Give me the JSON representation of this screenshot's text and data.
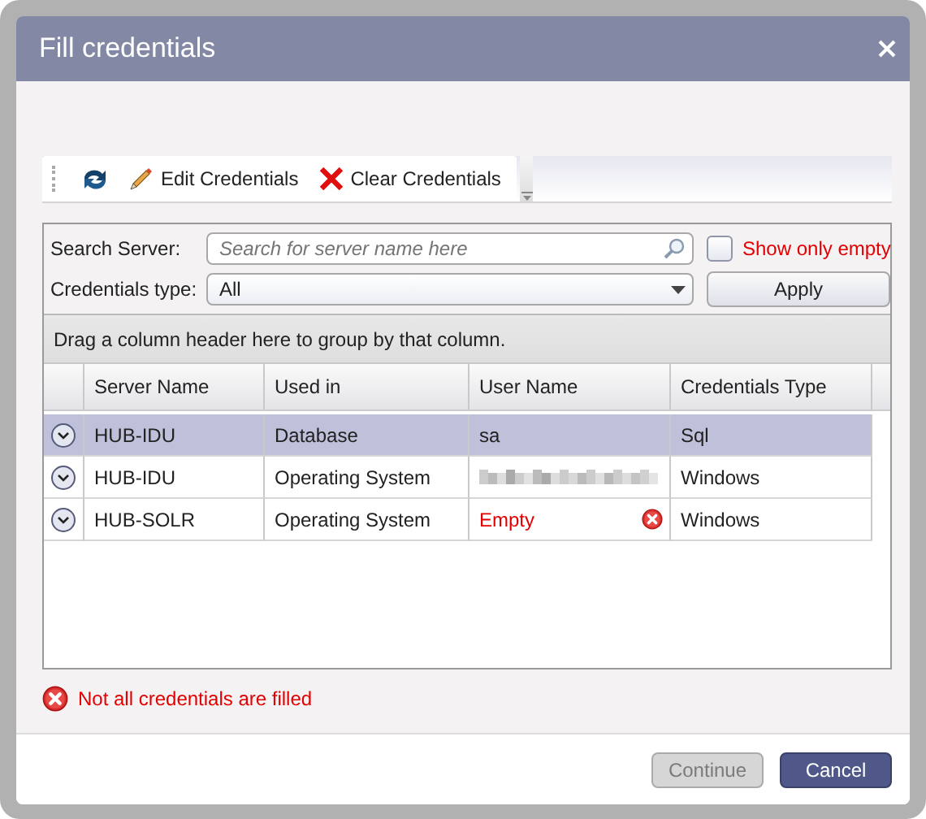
{
  "window": {
    "title": "Fill credentials"
  },
  "toolbar": {
    "items": [
      {
        "kind": "refresh"
      },
      {
        "kind": "edit",
        "label": "Edit Credentials"
      },
      {
        "kind": "clear",
        "label": "Clear Credentials"
      }
    ]
  },
  "filters": {
    "search": {
      "label": "Search Server:",
      "placeholder": "Search for server name here"
    },
    "type": {
      "label": "Credentials type:",
      "value": "All"
    },
    "show_only_empty": {
      "label": "Show only empty",
      "checked": false
    },
    "apply_button": "Apply"
  },
  "group_panel": "Drag a column header here to group by that column.",
  "table": {
    "columns": [
      "Server Name",
      "Used in",
      "User Name",
      "Credentials Type"
    ],
    "rows": [
      {
        "selected": true,
        "cells": [
          {
            "kind": "text",
            "text": "HUB-IDU"
          },
          {
            "kind": "text",
            "text": "Database"
          },
          {
            "kind": "text",
            "text": "sa"
          },
          {
            "kind": "text",
            "text": "Sql"
          }
        ]
      },
      {
        "selected": false,
        "cells": [
          {
            "kind": "text",
            "text": "HUB-IDU"
          },
          {
            "kind": "text",
            "text": "Operating System"
          },
          {
            "kind": "redacted"
          },
          {
            "kind": "text",
            "text": "Windows"
          }
        ]
      },
      {
        "selected": false,
        "cells": [
          {
            "kind": "text",
            "text": "HUB-SOLR"
          },
          {
            "kind": "text",
            "text": "Operating System"
          },
          {
            "kind": "empty",
            "text": "Empty"
          },
          {
            "kind": "text",
            "text": "Windows"
          }
        ]
      }
    ]
  },
  "error_message": "Not all credentials are filled",
  "buttons": [
    {
      "label": "Continue",
      "disabled": true
    },
    {
      "label": "Cancel",
      "disabled": false
    }
  ]
}
